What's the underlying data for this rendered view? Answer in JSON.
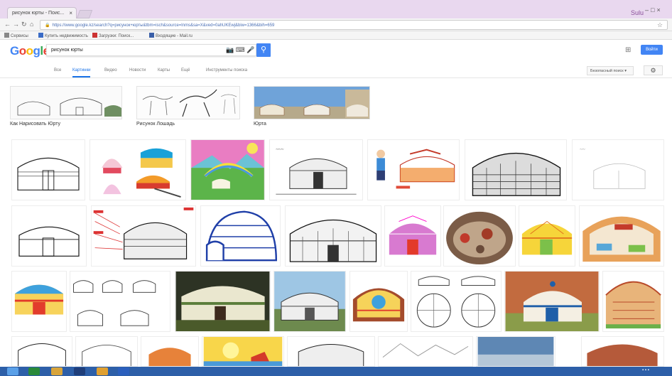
{
  "browser": {
    "tab_title": "рисунок юрты - Поис...",
    "url": "https://www.google.kz/search?q=рисунок+юрты&tbm=isch&source=lnms&sa=X&ved=0ahUKEwj&biw=1366&bih=659",
    "user_badge": "Sulu",
    "bookmarks": [
      "Сервисы",
      "Купить недвижимость",
      "Загрузки: Поиск...",
      "Входящие - Mail.ru"
    ]
  },
  "google": {
    "logo": "Google",
    "query": "рисунок юрты",
    "sign_in": "Войти",
    "safe_search": "Безопасный поиск",
    "tabs": [
      "Все",
      "Картинки",
      "Видео",
      "Новости",
      "Карты",
      "Ещё",
      "Инструменты поиска"
    ],
    "active_tab_index": 1
  },
  "related": [
    {
      "label": "Как Нарисовать Юрту"
    },
    {
      "label": "Рисунок Лошадь"
    },
    {
      "label": "Юрта"
    }
  ],
  "colors": {
    "google_blue": "#4285f4",
    "google_red": "#ea4335",
    "google_yellow": "#fbbc05",
    "google_green": "#34a853",
    "taskbar": "#2d5fa8",
    "chrome_frame": "#e9d8ef"
  }
}
